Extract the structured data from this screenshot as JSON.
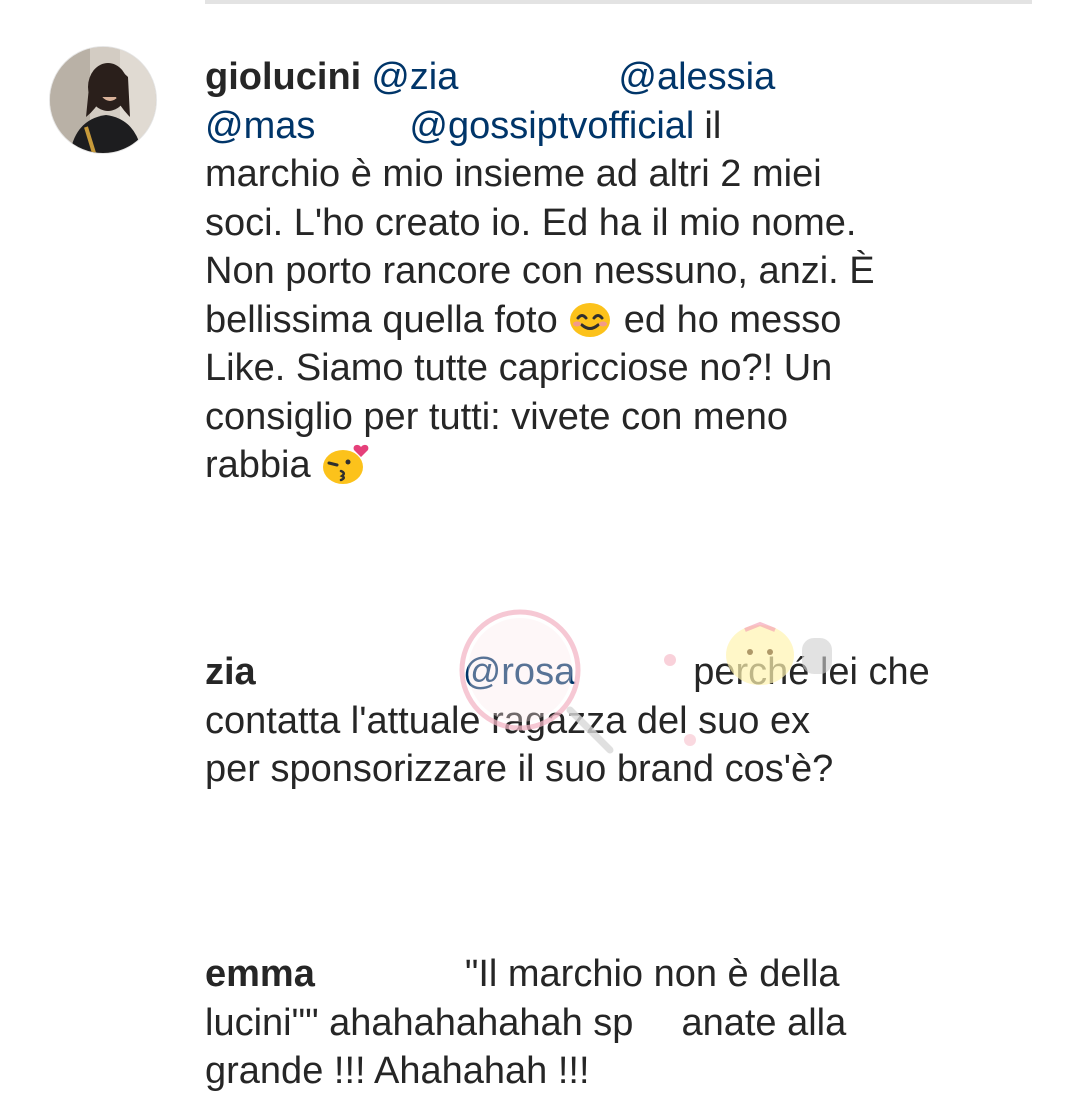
{
  "comments": [
    {
      "username": "giolucini",
      "mentions": [
        "@zia",
        "@alessia",
        "@mas",
        "@gossiptvofficial"
      ],
      "text_lines": [
        "il",
        "marchio è mio insieme ad altri 2 miei",
        "soci. L'ho creato io. Ed ha il mio nome.",
        "Non porto rancore con nessuno, anzi. È",
        "bellissima quella foto",
        "ed ho messo",
        "Like. Siamo tutte capricciose no?! Un",
        "consiglio per tutti: vivete con meno",
        "rabbia"
      ],
      "emojis": [
        "smiling-face-icon",
        "kissing-face-icon"
      ]
    },
    {
      "username": "zia",
      "mentions": [
        "@rosa"
      ],
      "text_lines": [
        "perché lei che",
        "contatta l'attuale ragazza del suo ex",
        "per sponsorizzare il suo brand cos'è?"
      ]
    },
    {
      "username": "emma",
      "text_lines": [
        "\"Il marchio non è della",
        "lucini\"\" ahahahahahah sp",
        "anate alla",
        "grande !!! Ahahahah !!!"
      ]
    }
  ],
  "colors": {
    "text": "#262626",
    "mention": "#003569",
    "divider": "#e3e3e3",
    "background": "#ffffff"
  }
}
